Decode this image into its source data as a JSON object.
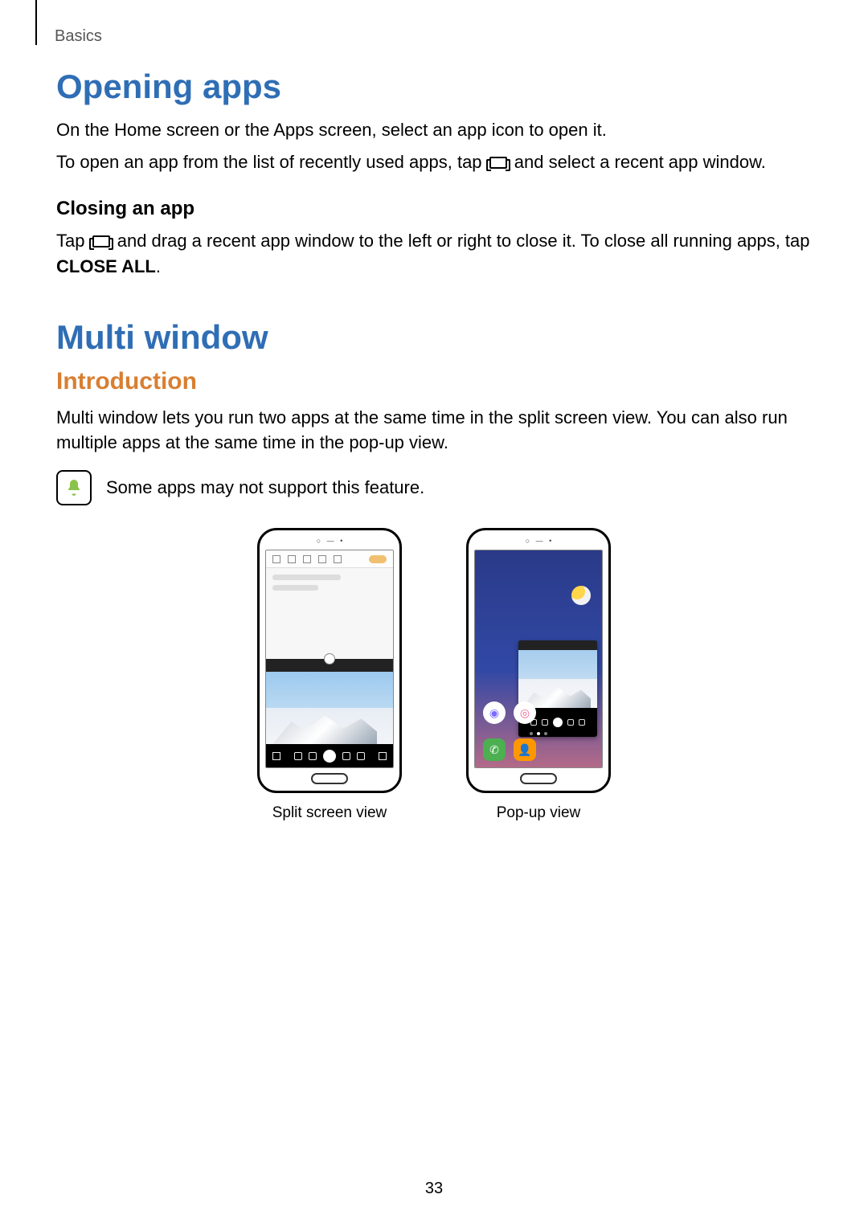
{
  "header": {
    "section": "Basics"
  },
  "opening_apps": {
    "heading": "Opening apps",
    "p1": "On the Home screen or the Apps screen, select an app icon to open it.",
    "p2a": "To open an app from the list of recently used apps, tap ",
    "p2b": " and select a recent app window."
  },
  "closing": {
    "heading": "Closing an app",
    "p_a": "Tap ",
    "p_b": " and drag a recent app window to the left or right to close it. To close all running apps, tap ",
    "bold": "CLOSE ALL",
    "p_c": "."
  },
  "multi": {
    "heading": "Multi window",
    "intro_heading": "Introduction",
    "intro_body": "Multi window lets you run two apps at the same time in the split screen view. You can also run multiple apps at the same time in the pop-up view.",
    "note": "Some apps may not support this feature."
  },
  "figures": {
    "split_caption": "Split screen view",
    "popup_caption": "Pop-up view"
  },
  "page_number": "33"
}
